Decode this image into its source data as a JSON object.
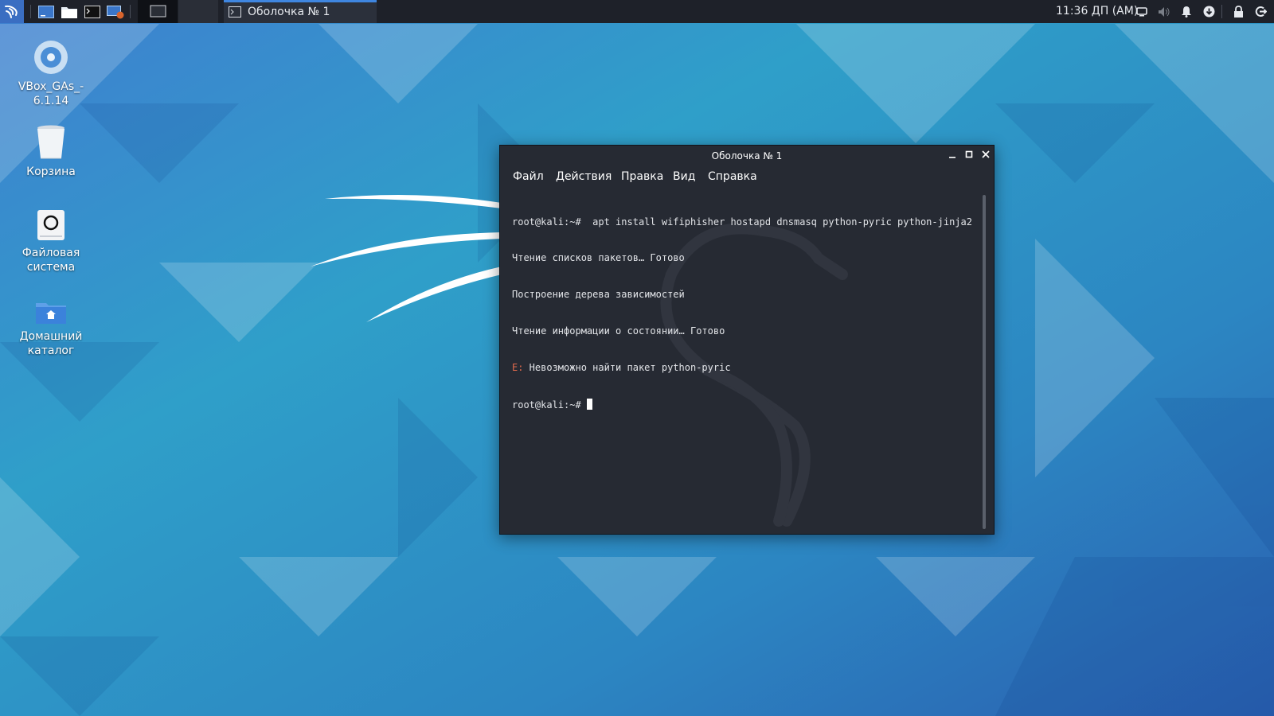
{
  "colors": {
    "panel_bg": "#1e2129",
    "terminal_bg": "#262a33",
    "error_prefix": "#e06a4d",
    "active_task_accent": "#3f86e0"
  },
  "top_panel": {
    "menu_icon": "kali-dragon-icon",
    "launchers": [
      "show-desktop-icon",
      "file-manager-icon",
      "terminal-icon",
      "system-monitor-icon"
    ],
    "workspace_icon": "workspace-icon",
    "active_task": {
      "icon": "terminal-icon",
      "label": "Оболочка № 1"
    },
    "clock": "11:36 ДП (AM)",
    "tray_icons": [
      "display-icon",
      "volume-muted-icon",
      "notifications-bell-icon",
      "update-icon",
      "lock-icon",
      "logout-icon"
    ]
  },
  "desktop_icons": [
    {
      "name": "vbox-disc",
      "icon": "cd-disc-icon",
      "label_line1": "VBox_GAs_-",
      "label_line2": "6.1.14"
    },
    {
      "name": "trash",
      "icon": "trash-icon",
      "label_line1": "Корзина",
      "label_line2": ""
    },
    {
      "name": "filesystem",
      "icon": "drive-icon",
      "label_line1": "Файловая",
      "label_line2": "система"
    },
    {
      "name": "home",
      "icon": "home-folder-icon",
      "label_line1": "Домашний",
      "label_line2": "каталог"
    }
  ],
  "terminal": {
    "title": "Оболочка № 1",
    "menu": [
      "Файл",
      "Действия",
      "Правка",
      "Вид",
      "Справка"
    ],
    "lines": {
      "cmd": "root@kali:~#  apt install wifiphisher hostapd dnsmasq python-pyric python-jinja2",
      "l1": "Чтение списков пакетов… Готово",
      "l2": "Построение дерева зависимостей",
      "l3": "Чтение информации о состоянии… Готово",
      "err_prefix": "E:",
      "err_text": " Невозможно найти пакет python-pyric",
      "prompt": "root@kali:~# "
    }
  }
}
